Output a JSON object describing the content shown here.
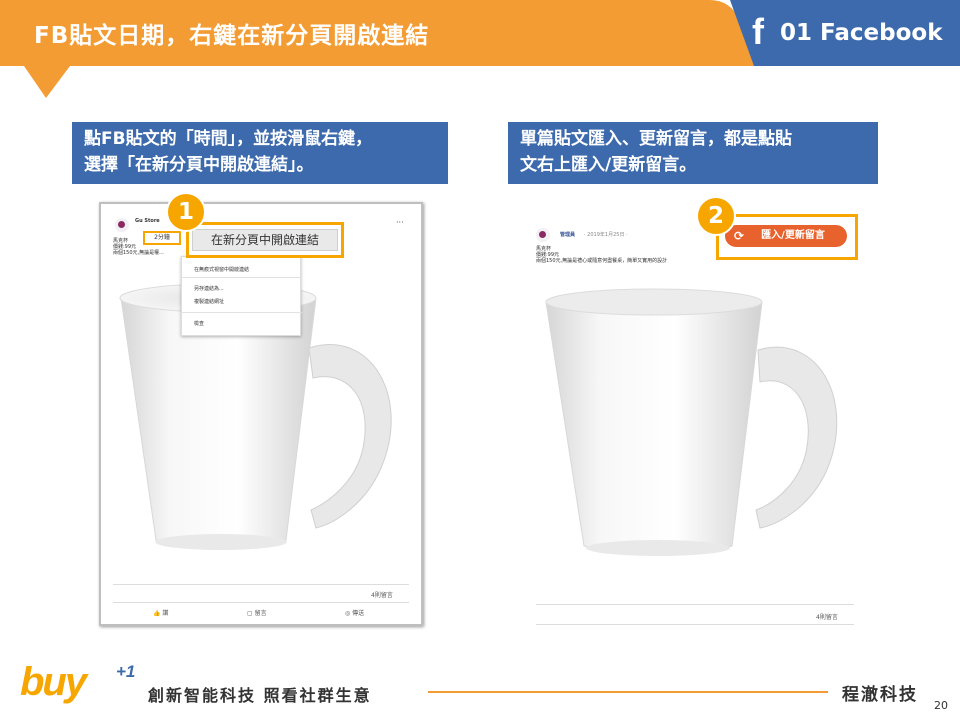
{
  "header": {
    "title": "FB貼文日期，右鍵在新分頁開啟連結",
    "section_icon": "facebook-f-icon",
    "section_label": "01 Facebook",
    "colors": {
      "orange": "#f39c33",
      "blue": "#3c6aac"
    }
  },
  "left_callout": {
    "line1": "點FB貼文的「時間」，並按滑鼠右鍵，",
    "line2": "選擇「在新分頁中開啟連結」。"
  },
  "right_callout": {
    "line1": "單篇貼文匯入、更新留言，都是點貼",
    "line2": "文右上匯入/更新留言。"
  },
  "left_shot": {
    "step": "1",
    "page_name": "Gu Store",
    "time": "2分鐘",
    "more": "···",
    "post_lines": [
      "馬克杯",
      "價錢:99元",
      "兩個150元,無論是權..."
    ],
    "context_menu": {
      "highlighted": "在新分頁中開啟連結",
      "items": [
        "在無痕式視窗中開啟連結",
        "另存連結為...",
        "複製連結網址",
        "檢查"
      ]
    },
    "comment_count": "4則留言",
    "actions": {
      "like": "讚",
      "comment": "留言",
      "share": "傳送"
    }
  },
  "right_shot": {
    "step": "2",
    "page_name": "管理員",
    "post_date": "· 2019年1月25日 · ",
    "post_lines": [
      "馬克杯",
      "價錢:99元",
      "兩個150元,無論是禮心或隨意何盡餐桌，簡單又實用的設計"
    ],
    "import_button": "匯入/更新留言",
    "comment_count": "4則留言"
  },
  "footer": {
    "brand": "buy",
    "brand_sup": "+1",
    "tagline": "創新智能科技 照看社群生意",
    "company": "程澈科技",
    "page": "20"
  }
}
